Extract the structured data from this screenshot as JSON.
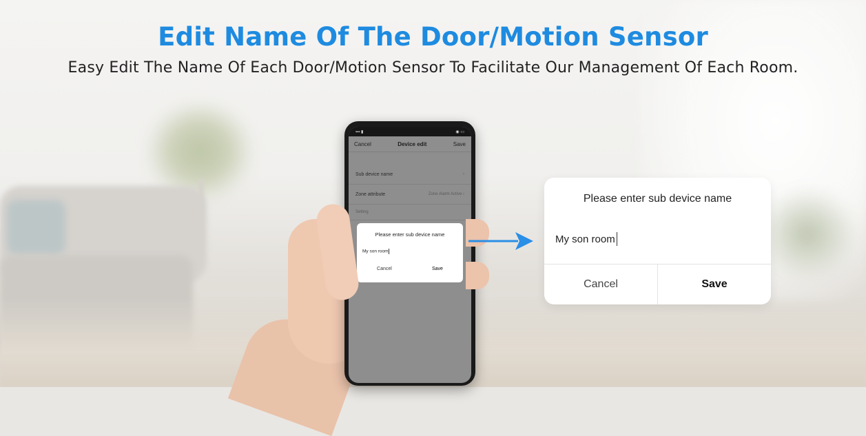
{
  "header": {
    "title": "Edit Name Of The Door/Motion Sensor",
    "subtitle": "Easy Edit The Name Of Each Door/Motion Sensor To Facilitate Our Management Of Each Room."
  },
  "phone": {
    "appbar": {
      "cancel": "Cancel",
      "title": "Device edit",
      "save": "Save"
    },
    "rows": [
      {
        "label": "Sub device name",
        "value": ""
      },
      {
        "label": "Zone attribute",
        "value": "Zone Alarm Active"
      }
    ],
    "section_label": "Setting",
    "dialog": {
      "title": "Please enter sub device name",
      "input_value": "My son room",
      "cancel": "Cancel",
      "save": "Save"
    }
  },
  "dialog": {
    "title": "Please enter sub device name",
    "input_value": "My son room",
    "cancel_label": "Cancel",
    "save_label": "Save"
  },
  "colors": {
    "title": "#1e8be0",
    "arrow": "#2a8fe6",
    "subtitle": "#222222"
  },
  "icons": {
    "arrow": "arrow-right-icon",
    "chevron": "chevron-right-icon"
  }
}
